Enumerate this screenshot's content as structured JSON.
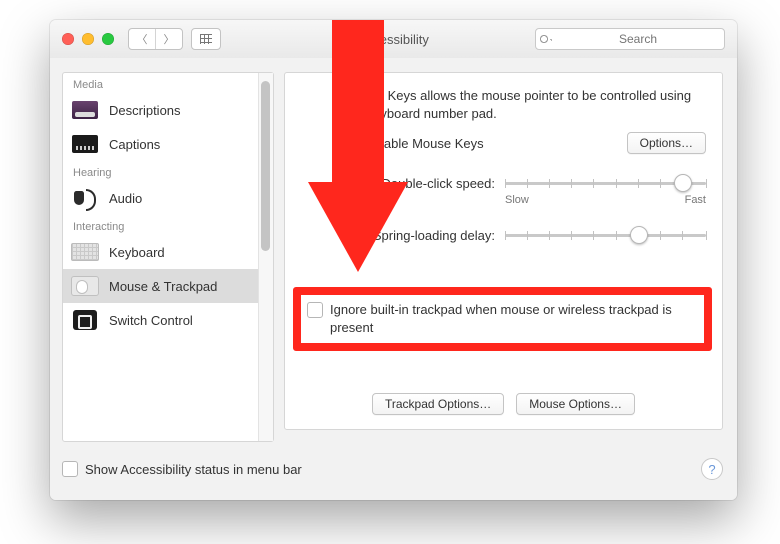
{
  "window": {
    "title": "Accessibility"
  },
  "search": {
    "placeholder": "Search"
  },
  "sidebar": {
    "groups": [
      {
        "label": "Media",
        "items": [
          {
            "label": "Descriptions"
          },
          {
            "label": "Captions"
          }
        ]
      },
      {
        "label": "Hearing",
        "items": [
          {
            "label": "Audio"
          }
        ]
      },
      {
        "label": "Interacting",
        "items": [
          {
            "label": "Keyboard"
          },
          {
            "label": "Mouse & Trackpad",
            "selected": true
          },
          {
            "label": "Switch Control"
          }
        ]
      }
    ]
  },
  "pane": {
    "description": "Mouse Keys allows the mouse pointer to be controlled using the keyboard number pad.",
    "enable_label": "Enable Mouse Keys",
    "options_button": "Options…",
    "dblclick_label": "Double-click speed:",
    "dblclick_min": "Slow",
    "dblclick_max": "Fast",
    "spring_label": "Spring-loading delay:",
    "ignore_label": "Ignore built-in trackpad when mouse or wireless trackpad is present",
    "trackpad_options": "Trackpad Options…",
    "mouse_options": "Mouse Options…"
  },
  "footer": {
    "menubar_label": "Show Accessibility status in menu bar"
  }
}
